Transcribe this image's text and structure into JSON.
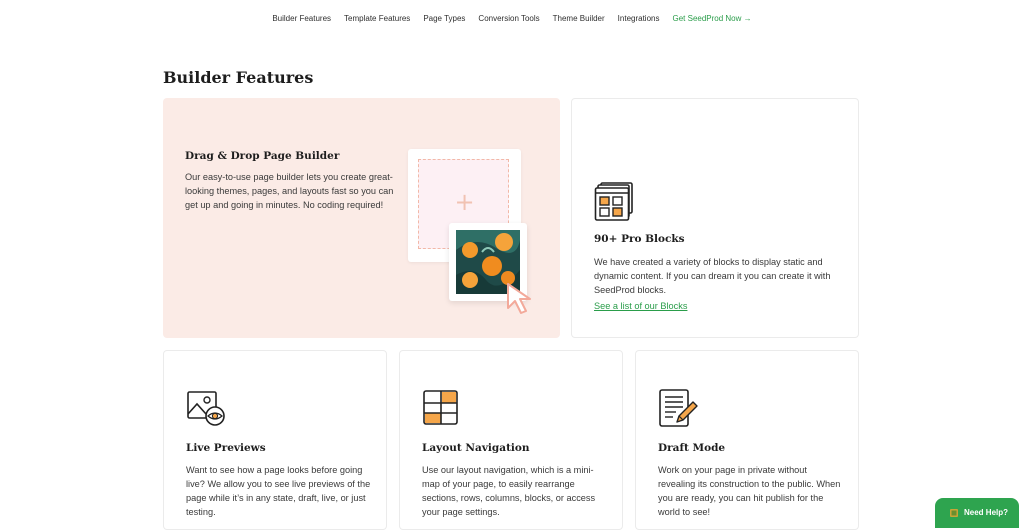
{
  "nav": {
    "items": [
      "Builder Features",
      "Template Features",
      "Page Types",
      "Conversion Tools",
      "Theme Builder",
      "Integrations"
    ],
    "cta": "Get SeedProd Now →"
  },
  "section": {
    "title": "Builder Features"
  },
  "hero": {
    "title": "Drag & Drop Page Builder",
    "text": "Our easy-to-use page builder lets you create great-looking themes, pages, and layouts fast so you can get up and going in minutes. No coding required!",
    "plus_glyph": "+"
  },
  "pro_blocks": {
    "title": "90+ Pro Blocks",
    "text": "We have created a variety of blocks to display static and dynamic content. If you can dream it you can create it with SeedProd blocks.",
    "link": "See a list of our Blocks"
  },
  "features": [
    {
      "title": "Live Previews",
      "text": "Want to see how a page looks before going live? We allow you to see live previews of the page while it’s in any state, draft, live, or just testing.",
      "icon": "image-preview-eye-icon"
    },
    {
      "title": "Layout Navigation",
      "text": "Use our layout navigation, which is a mini-map of your page, to easily rearrange sections, rows, columns, blocks, or access your page settings.",
      "icon": "layout-grid-icon"
    },
    {
      "title": "Draft Mode",
      "text": "Work on your page in private without revealing its construction to the public. When you are ready, you can hit publish for the world to see!",
      "icon": "document-pencil-icon"
    }
  ],
  "help": {
    "label": "Need Help?"
  },
  "colors": {
    "accent": "#2a9d4a",
    "hero_bg": "#fbebe6",
    "icon_orange": "#f5a64a",
    "help_bg": "#2ea44f"
  }
}
